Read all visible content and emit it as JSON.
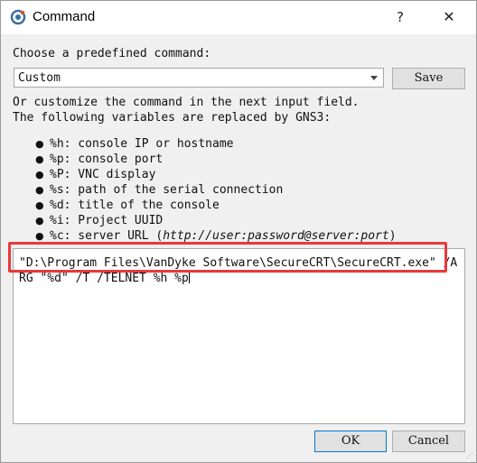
{
  "window": {
    "title": "Command",
    "help_glyph": "?",
    "close_glyph": "✕"
  },
  "labels": {
    "choose": "Choose a predefined command:",
    "customize_line1": "Or customize the command in the next input field.",
    "customize_line2": "The following variables are replaced by GNS3:"
  },
  "predefined_select": {
    "value": "Custom"
  },
  "buttons": {
    "save": "Save",
    "ok": "OK",
    "cancel": "Cancel"
  },
  "variables": [
    {
      "text": "%h: console IP or hostname"
    },
    {
      "text": "%p: console port"
    },
    {
      "text": "%P: VNC display"
    },
    {
      "text": "%s: path of the serial connection"
    },
    {
      "text": "%d: title of the console"
    },
    {
      "text": "%i: Project UUID"
    },
    {
      "text": "%c: server URL (",
      "italic": "http://user:password@server:port",
      "suffix": ")"
    }
  ],
  "command_text": "\"D:\\Program Files\\VanDyke Software\\SecureCRT\\SecureCRT.exe\" /ARG \"%d\" /T /TELNET %h %p",
  "colors": {
    "highlight": "#e8393a",
    "accent": "#0078d7"
  }
}
